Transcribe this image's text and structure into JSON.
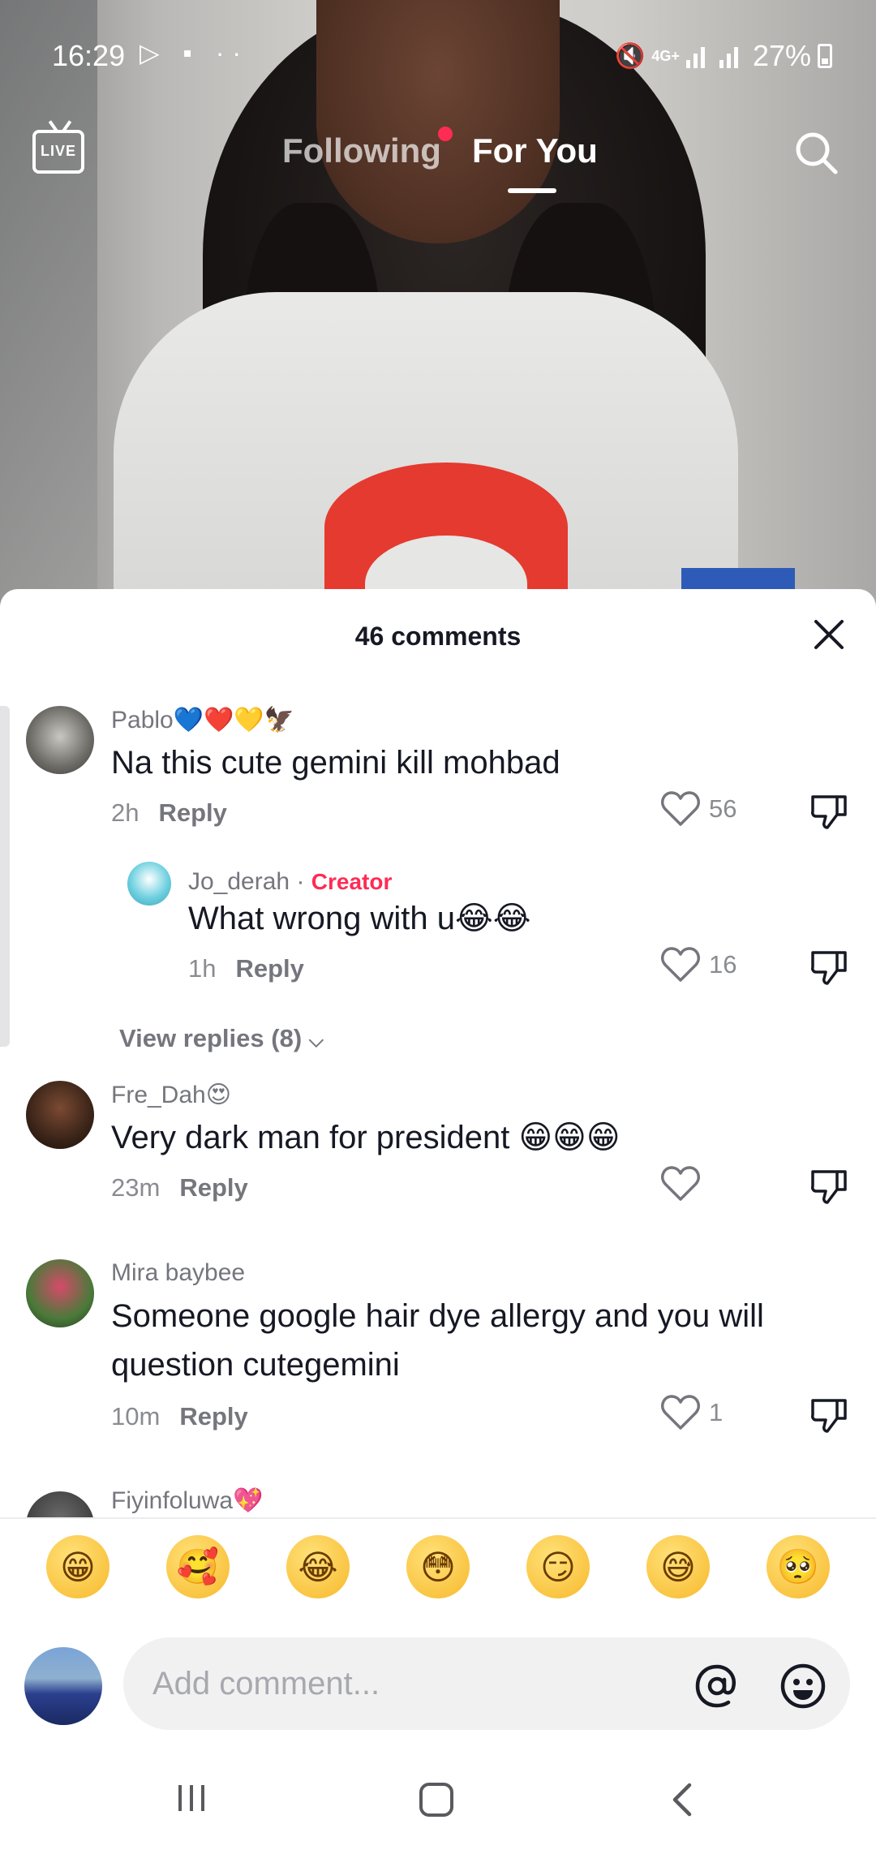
{
  "status_bar": {
    "time": "16:29",
    "network": "4G+",
    "battery": "27%"
  },
  "top_nav": {
    "live_label": "LIVE",
    "tabs": [
      {
        "label": "Following"
      },
      {
        "label": "For You"
      }
    ]
  },
  "comments_sheet": {
    "title": "46 comments",
    "reply_label": "Reply",
    "view_replies": "View replies (8)",
    "comments": [
      {
        "user": "Pablo💙❤️💛🦅",
        "text": "Na this cute gemini kill mohbad",
        "time": "2h",
        "likes": "56"
      },
      {
        "user": "Jo_derah",
        "badge": "Creator",
        "separator": "·",
        "text": "What wrong with u😂😂",
        "time": "1h",
        "likes": "16"
      },
      {
        "user": "Fre_Dah😍",
        "text": "Very dark man for president 😁😁😁",
        "time": "23m",
        "likes": ""
      },
      {
        "user": "Mira baybee",
        "text": "Someone google hair dye allergy and you will question cutegemini",
        "time": "10m",
        "likes": "1"
      },
      {
        "user": "Fiyinfoluwa💖"
      }
    ]
  },
  "emoji_bar": [
    "😁",
    "🥰",
    "😂",
    "😳",
    "😏",
    "😅",
    "🥺"
  ],
  "composer": {
    "placeholder": "Add comment..."
  },
  "colors": {
    "accent": "#fe2c55",
    "text_primary": "#161823",
    "text_secondary": "#75767d"
  }
}
